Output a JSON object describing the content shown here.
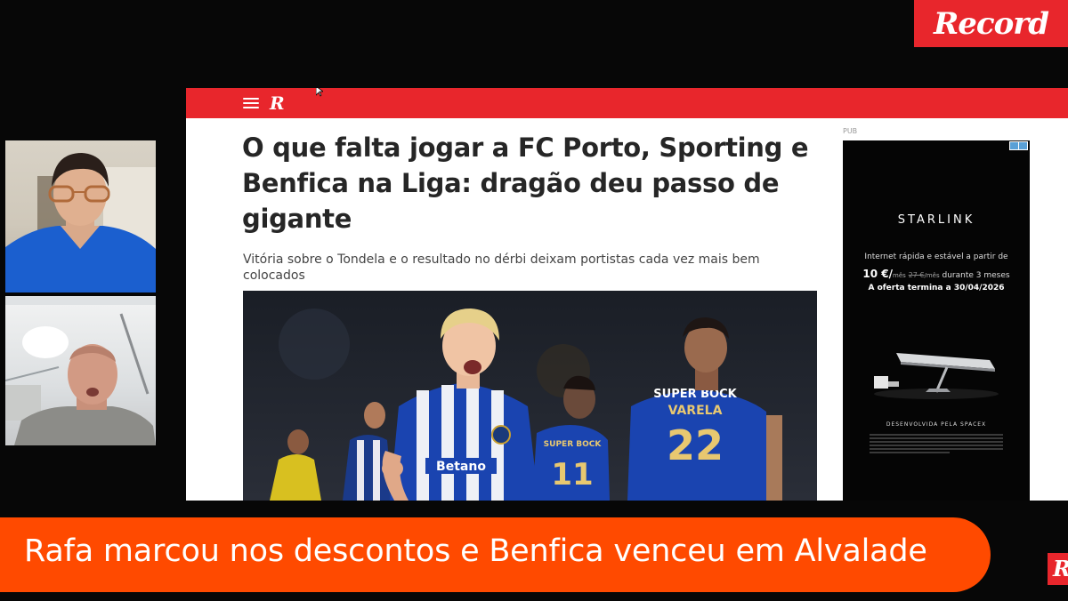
{
  "brand": {
    "logo_text": "Record",
    "accent_color": "#e8262c"
  },
  "site": {
    "logo_text": "R",
    "article": {
      "headline": "O que falta jogar a FC Porto, Sporting e Benfica na Liga: dragão deu passo de gigante",
      "subheadline": "Vitória sobre o Tondela e o resultado no dérbi deixam portistas cada vez mais bem colocados",
      "photo_jerseys": {
        "sponsor": "SUPER BOCK",
        "name": "VARELA",
        "number": "22"
      }
    },
    "ad": {
      "pub_label": "PUB",
      "brand": "STARLINK",
      "line1": "Internet rápida e estável a partir de",
      "price": "10 €/",
      "price_unit": "mês",
      "old_price": "27 €",
      "old_unit": "/mês",
      "price_suffix": " durante 3 meses",
      "line3": "A oferta termina a 30/04/2026",
      "developed_by": "DESENVOLVIDA PELA SPACEX"
    }
  },
  "lower_third": {
    "text": "Rafa marcou nos descontos e Benfica venceu em Alvalade",
    "color": "#ff4a00"
  },
  "corner_logo": "R"
}
